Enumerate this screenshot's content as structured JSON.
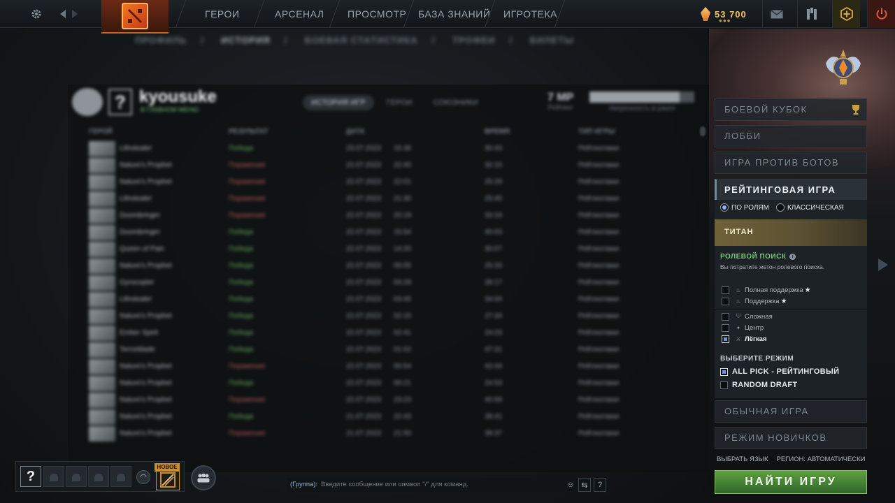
{
  "topbar": {
    "nav": [
      "ГЕРОИ",
      "АРСЕНАЛ",
      "ПРОСМОТР",
      "БАЗА ЗНАНИЙ",
      "ИГРОТЕКА"
    ],
    "currency": "53 700",
    "icons": [
      "gear-icon",
      "back-icon",
      "forward-icon",
      "mail-icon",
      "armory-icon",
      "plus-icon",
      "power-icon"
    ]
  },
  "subnav": {
    "items": [
      "ПРОФИЛЬ",
      "ИСТОРИЯ",
      "БОЕВАЯ СТАТИСТИКА",
      "ТРОФЕИ",
      "БИЛЕТЫ"
    ],
    "separator": "/",
    "active_index": 1
  },
  "profile": {
    "name": "kyousuke",
    "status": "В ГЛАВНОМ МЕНЮ",
    "rank_badge": "?",
    "tabs": [
      "ИСТОРИЯ ИГР",
      "ГЕРОИ",
      "СОЮЗНИКИ"
    ],
    "mmr": "7 МР",
    "mmr_label": "Рейтинг",
    "progress_value": 0.86,
    "progress_text": "86%",
    "progress_label": "Уверенность в ранге"
  },
  "match_table": {
    "headers": [
      "ГЕРОЙ",
      "РЕЗУЛЬТАТ",
      "ДАТА",
      "ВРЕМЯ",
      "ТИП ИГРЫ"
    ],
    "rows": [
      {
        "hero": "Lifestealer",
        "result": "Победа",
        "win": true,
        "date": "23.07.2023",
        "time": "15:36",
        "duration": "30:43",
        "type": "Рейтинговая"
      },
      {
        "hero": "Nature's Prophet",
        "result": "Поражение",
        "win": false,
        "date": "22.07.2023",
        "time": "22:40",
        "duration": "32:15",
        "type": "Рейтинговая"
      },
      {
        "hero": "Nature's Prophet",
        "result": "Поражение",
        "win": false,
        "date": "22.07.2023",
        "time": "22:01",
        "duration": "25:29",
        "type": "Рейтинговая"
      },
      {
        "hero": "Lifestealer",
        "result": "Поражение",
        "win": false,
        "date": "22.07.2023",
        "time": "21:30",
        "duration": "25:45",
        "type": "Рейтинговая"
      },
      {
        "hero": "Doombringer",
        "result": "Поражение",
        "win": false,
        "date": "22.07.2023",
        "time": "20:19",
        "duration": "33:19",
        "type": "Рейтинговая"
      },
      {
        "hero": "Doombringer",
        "result": "Победа",
        "win": true,
        "date": "22.07.2023",
        "time": "15:54",
        "duration": "40:03",
        "type": "Рейтинговая"
      },
      {
        "hero": "Queen of Pain",
        "result": "Победа",
        "win": true,
        "date": "22.07.2023",
        "time": "14:20",
        "duration": "30:07",
        "type": "Рейтинговая"
      },
      {
        "hero": "Nature's Prophet",
        "result": "Победа",
        "win": true,
        "date": "22.07.2023",
        "time": "05:05",
        "duration": "25:33",
        "type": "Рейтинговая"
      },
      {
        "hero": "Gyrocopter",
        "result": "Победа",
        "win": true,
        "date": "22.07.2023",
        "time": "04:28",
        "duration": "28:17",
        "type": "Рейтинговая"
      },
      {
        "hero": "Lifestealer",
        "result": "Победа",
        "win": true,
        "date": "22.07.2023",
        "time": "03:45",
        "duration": "34:04",
        "type": "Рейтинговая"
      },
      {
        "hero": "Nature's Prophet",
        "result": "Победа",
        "win": true,
        "date": "22.07.2023",
        "time": "02:15",
        "duration": "27:34",
        "type": "Рейтинговая"
      },
      {
        "hero": "Ember Spirit",
        "result": "Победа",
        "win": true,
        "date": "22.07.2023",
        "time": "02:41",
        "duration": "24:23",
        "type": "Рейтинговая"
      },
      {
        "hero": "Terrorblade",
        "result": "Победа",
        "win": true,
        "date": "22.07.2023",
        "time": "01:02",
        "duration": "47:31",
        "type": "Рейтинговая"
      },
      {
        "hero": "Nature's Prophet",
        "result": "Поражение",
        "win": false,
        "date": "22.07.2023",
        "time": "00:54",
        "duration": "42:44",
        "type": "Рейтинговая"
      },
      {
        "hero": "Nature's Prophet",
        "result": "Победа",
        "win": true,
        "date": "22.07.2023",
        "time": "00:21",
        "duration": "24:53",
        "type": "Рейтинговая"
      },
      {
        "hero": "Nature's Prophet",
        "result": "Поражение",
        "win": false,
        "date": "22.07.2023",
        "time": "23:23",
        "duration": "40:59",
        "type": "Рейтинговая"
      },
      {
        "hero": "Nature's Prophet",
        "result": "Победа",
        "win": true,
        "date": "21.07.2023",
        "time": "22:43",
        "duration": "28:41",
        "type": "Рейтинговая"
      },
      {
        "hero": "Nature's Prophet",
        "result": "Поражение",
        "win": false,
        "date": "21.07.2023",
        "time": "21:50",
        "duration": "39:37",
        "type": "Рейтинговая"
      }
    ]
  },
  "play_panel": {
    "modes_top": [
      "БОЕВОЙ КУБОК",
      "ЛОББИ",
      "ИГРА ПРОТИВ БОТОВ"
    ],
    "selected_mode": "РЕЙТИНГОВАЯ ИГРА",
    "queue_options": [
      {
        "label": "ПО РОЛЯМ",
        "selected": true
      },
      {
        "label": "КЛАССИЧЕСКАЯ",
        "selected": false
      }
    ],
    "rank_name": "ТИТАН",
    "role_search_title": "РОЛЕВОЙ ПОИСК",
    "role_search_note": "Вы потратите жетон ролевого поиска.",
    "support_roles": [
      {
        "label": "Полная поддержка",
        "icon": "support-icon",
        "star": true,
        "checked": false
      },
      {
        "label": "Поддержка",
        "icon": "support-icon",
        "star": true,
        "checked": false
      }
    ],
    "core_roles": [
      {
        "label": "Сложная",
        "icon": "shield-icon",
        "checked": false
      },
      {
        "label": "Центр",
        "icon": "mid-icon",
        "checked": false
      },
      {
        "label": "Лёгкая",
        "icon": "sword-icon",
        "checked": true
      }
    ],
    "mode_select_title": "ВЫБЕРИТЕ РЕЖИМ",
    "game_modes": [
      {
        "label": "ALL PICK - РЕЙТИНГОВЫЙ",
        "checked": true
      },
      {
        "label": "RANDOM DRAFT",
        "checked": false
      }
    ],
    "modes_bottom": [
      "ОБЫЧНАЯ ИГРА",
      "РЕЖИМ НОВИЧКОВ"
    ],
    "language_link": "ВЫБРАТЬ ЯЗЫК",
    "region_link": "РЕГИОН: АВТОМАТИЧЕСКИ",
    "find_button": "НАЙТИ ИГРУ"
  },
  "party": {
    "me_badge": "?",
    "empty_slots": 4,
    "new_badge": "НОВОЕ"
  },
  "chat": {
    "channel": "(Группа):",
    "placeholder": "Введите сообщение или символ \"/\" для команд."
  },
  "colors": {
    "win": "#66a95e",
    "loss": "#b55a55",
    "accent_green": "#78c878",
    "find_button": "#4c8c38",
    "gold": "#f2c55c"
  }
}
